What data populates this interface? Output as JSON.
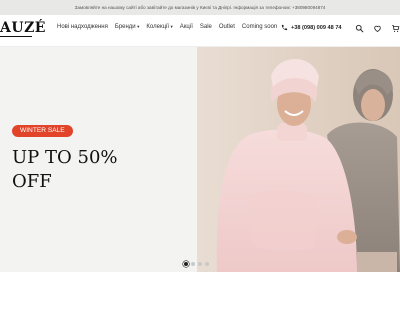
{
  "announcement": "Замовляйте на нашому сайті або завітайте до магазинів у Києві та Дніпрі. Інформація за телефоном: +380980094874",
  "header": {
    "logo_text": "AUZÉ",
    "nav": [
      {
        "label": "Нові надходження",
        "dropdown": false
      },
      {
        "label": "Бренди",
        "dropdown": true
      },
      {
        "label": "Колекції",
        "dropdown": true
      },
      {
        "label": "Акції",
        "dropdown": false
      },
      {
        "label": "Sale",
        "dropdown": false
      },
      {
        "label": "Outlet",
        "dropdown": false
      },
      {
        "label": "Coming soon",
        "dropdown": false
      }
    ],
    "phone": "+38 (098) 009 48 74",
    "icons": [
      "phone-icon",
      "search-icon",
      "heart-icon",
      "cart-icon"
    ],
    "dropdown_caret": "▾"
  },
  "hero": {
    "badge": "WINTER SALE",
    "headline_line1": "UP TO 50%",
    "headline_line2": "OFF",
    "slides_total": 4,
    "active_slide": 1
  },
  "colors": {
    "announcement_bg": "#e8e8e6",
    "badge": "#e2442a",
    "hero_bg": "#f3f3f2"
  }
}
